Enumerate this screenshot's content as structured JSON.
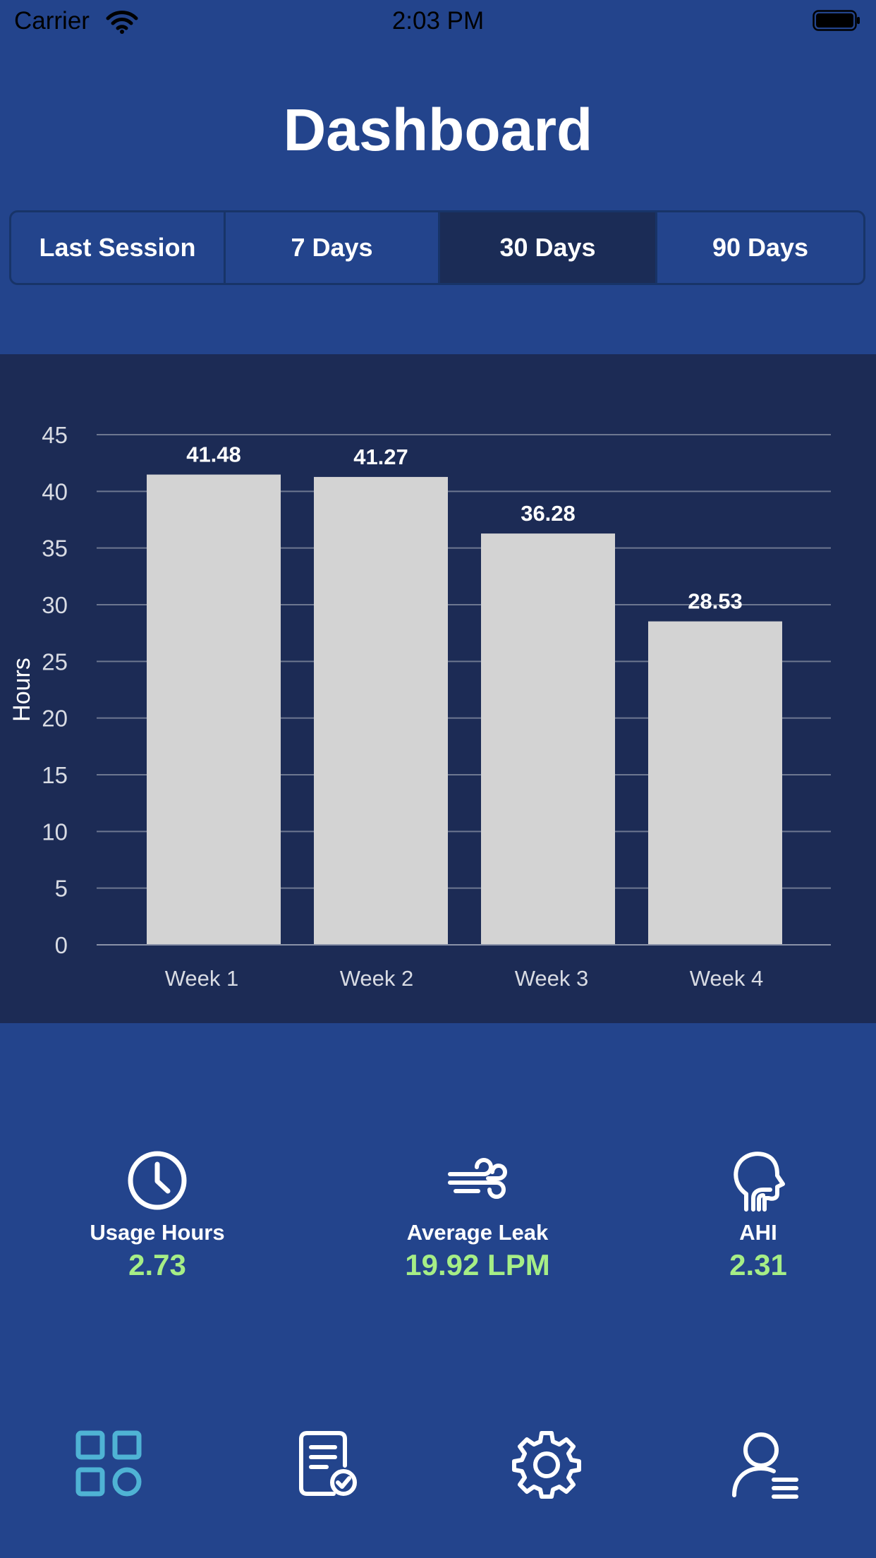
{
  "status_bar": {
    "carrier": "Carrier",
    "time": "2:03 PM"
  },
  "header": {
    "title": "Dashboard"
  },
  "period_tabs": [
    {
      "label": "Last Session",
      "selected": false
    },
    {
      "label": "7 Days",
      "selected": false
    },
    {
      "label": "30 Days",
      "selected": true
    },
    {
      "label": "90 Days",
      "selected": false
    }
  ],
  "chart_data": {
    "type": "bar",
    "categories": [
      "Week 1",
      "Week 2",
      "Week 3",
      "Week 4"
    ],
    "values": [
      41.48,
      41.27,
      36.28,
      28.53
    ],
    "data_labels": [
      "41.48",
      "41.27",
      "36.28",
      "28.53"
    ],
    "ylabel": "Hours",
    "xlabel": "",
    "ylim": [
      0,
      45
    ],
    "yticks": [
      0,
      5,
      10,
      15,
      20,
      25,
      30,
      35,
      40,
      45
    ],
    "grid": true,
    "bar_color": "#d3d3d3",
    "background": "#1c2b55"
  },
  "stats": {
    "usage": {
      "label": "Usage Hours",
      "value": "2.73",
      "icon": "clock-icon"
    },
    "leak": {
      "label": "Average Leak",
      "value": "19.92 LPM",
      "icon": "wind-icon"
    },
    "ahi": {
      "label": "AHI",
      "value": "2.31",
      "icon": "head-airway-icon"
    }
  },
  "tab_bar": {
    "items": [
      {
        "icon": "dashboard-grid-icon",
        "selected": true
      },
      {
        "icon": "report-document-icon",
        "selected": false
      },
      {
        "icon": "gear-icon",
        "selected": false
      },
      {
        "icon": "profile-icon",
        "selected": false
      }
    ]
  },
  "colors": {
    "background": "#23448c",
    "panel": "#1c2b55",
    "accent_value": "#a6ee86",
    "tab_active": "#4fb3d4"
  }
}
